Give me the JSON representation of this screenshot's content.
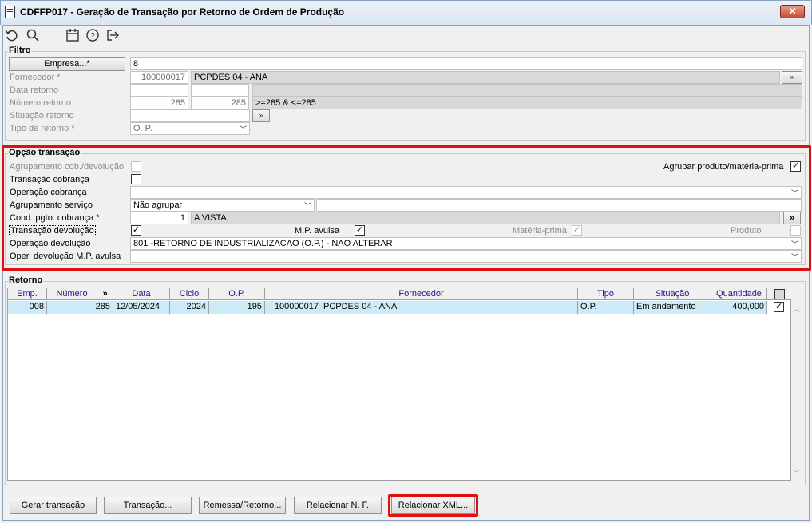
{
  "window": {
    "title": "CDFFP017 - Geração de Transação por Retorno de Ordem de Produção",
    "close_icon": "close-icon"
  },
  "toolbar": {
    "icons": [
      "undo-icon",
      "search-icon",
      "calendar-icon",
      "help-icon",
      "exit-icon"
    ]
  },
  "filtro": {
    "title": "Filtro",
    "empresa_label": "Empresa...*",
    "empresa_value": "8",
    "fornecedor_label": "Fornecedor *",
    "fornecedor_code": "100000017",
    "fornecedor_name": "PCPDES 04 - ANA",
    "data_retorno_label": "Data retorno",
    "numero_retorno_label": "Número retorno",
    "numero_de": "285",
    "numero_ate": "285",
    "numero_expr": ">=285 & <=285",
    "situacao_label": "Situação retorno",
    "tipo_label": "Tipo de retorno *",
    "tipo_value": "O. P."
  },
  "opcao": {
    "title": "Opção transação",
    "agrupamento_cob_label": "Agrupamento cob./devolução",
    "agrupar_produto_label": "Agrupar produto/matéria-prima",
    "agrupar_produto_checked": "✓",
    "transacao_cobranca_label": "Transação cobrança",
    "operacao_cobranca_label": "Operação cobrança",
    "agrupamento_servico_label": "Agrupamento serviço",
    "agrupamento_servico_value": "Não agrupar",
    "cond_pgto_label": "Cond. pgto. cobrança *",
    "cond_pgto_code": "1",
    "cond_pgto_name": "A VISTA",
    "cond_pgto_btn": "»",
    "transacao_devolucao_label": "Transação devolução",
    "transacao_devolucao_checked": "✓",
    "mp_avulsa_label": "M.P. avulsa",
    "mp_avulsa_checked": "✓",
    "materia_prima_label": "Matéria-prima",
    "materia_prima_checked": "✓",
    "produto_label": "Produto",
    "operacao_devolucao_label": "Operação devolução",
    "operacao_devolucao_value": "801 -RETORNO DE INDUSTRIALIZACAO (O.P.) - NAO ALTERAR",
    "oper_dev_mp_label": "Oper. devolução M.P. avulsa"
  },
  "retorno": {
    "title": "Retorno",
    "columns": [
      "Emp.",
      "Número",
      "»",
      "Data",
      "Ciclo",
      "O.P.",
      "Fornecedor",
      "Tipo",
      "Situação",
      "Quantidade"
    ],
    "rows": [
      {
        "emp": "008",
        "numero": "285",
        "data": "12/05/2024",
        "ciclo": "2024",
        "op": "195",
        "forn_code": "100000017",
        "forn_name": "PCPDES 04 - ANA",
        "tipo": "O.P.",
        "situacao": "Em andamento",
        "quantidade": "400,000",
        "checked": "✓"
      }
    ]
  },
  "buttons": {
    "gerar": "Gerar transação",
    "transacao": "Transação...",
    "remessa": "Remessa/Retorno...",
    "relacionar_nf": "Relacionar N. F.",
    "relacionar_xml": "Relacionar XML..."
  },
  "colors": {
    "highlight_red": "#e01010",
    "row_selected": "#cdeaf7",
    "header_text": "#1a1a8c"
  }
}
